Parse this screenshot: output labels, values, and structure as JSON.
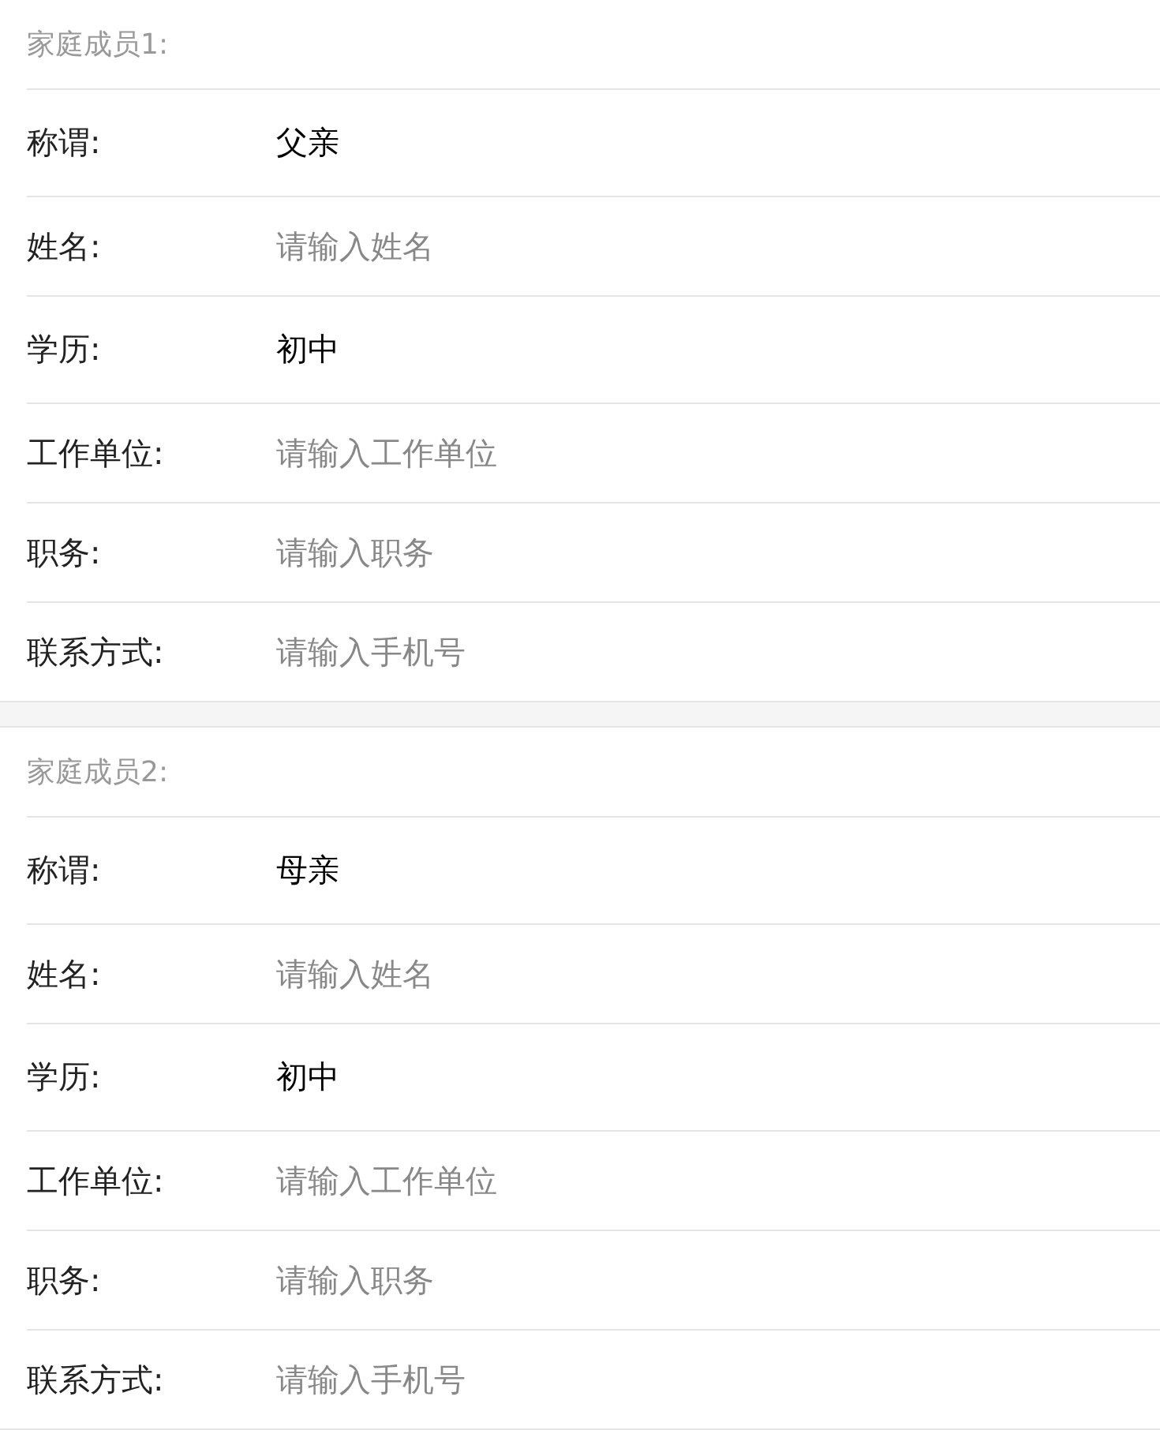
{
  "sections": [
    {
      "title": "家庭成员1:",
      "rows": [
        {
          "kind": "select",
          "label": "称谓:",
          "value": "父亲"
        },
        {
          "kind": "input",
          "label": "姓名:",
          "placeholder": "请输入姓名"
        },
        {
          "kind": "select",
          "label": "学历:",
          "value": "初中"
        },
        {
          "kind": "input",
          "label": "工作单位:",
          "placeholder": "请输入工作单位"
        },
        {
          "kind": "input",
          "label": "职务:",
          "placeholder": "请输入职务"
        },
        {
          "kind": "input",
          "label": "联系方式:",
          "placeholder": "请输入手机号"
        }
      ]
    },
    {
      "title": "家庭成员2:",
      "rows": [
        {
          "kind": "select",
          "label": "称谓:",
          "value": "母亲"
        },
        {
          "kind": "input",
          "label": "姓名:",
          "placeholder": "请输入姓名"
        },
        {
          "kind": "select",
          "label": "学历:",
          "value": "初中"
        },
        {
          "kind": "input",
          "label": "工作单位:",
          "placeholder": "请输入工作单位"
        },
        {
          "kind": "input",
          "label": "职务:",
          "placeholder": "请输入职务"
        },
        {
          "kind": "input",
          "label": "联系方式:",
          "placeholder": "请输入手机号"
        }
      ]
    }
  ]
}
